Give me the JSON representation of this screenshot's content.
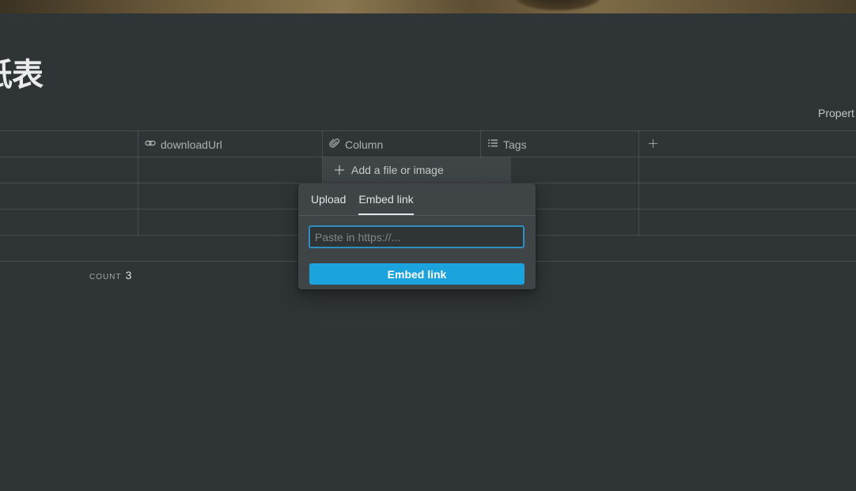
{
  "page": {
    "title": "纸表",
    "properties_label": "Propert"
  },
  "table": {
    "columns": [
      {
        "name": "downloadUrl",
        "icon": "link-icon"
      },
      {
        "name": "Column",
        "icon": "paperclip-icon"
      },
      {
        "name": "Tags",
        "icon": "list-icon"
      }
    ],
    "add_column_icon": "plus-icon",
    "count_label": "COUNT",
    "count_value": "3"
  },
  "cell_editor": {
    "add_label": "Add a file or image"
  },
  "popup": {
    "tabs": [
      {
        "label": "Upload"
      },
      {
        "label": "Embed link"
      }
    ],
    "active_tab": "Embed link",
    "input_placeholder": "Paste in https://...",
    "input_value": "",
    "button_label": "Embed link"
  },
  "colors": {
    "background": "#2f3437",
    "accent": "#1aa3dc",
    "popup": "#3f4447"
  }
}
